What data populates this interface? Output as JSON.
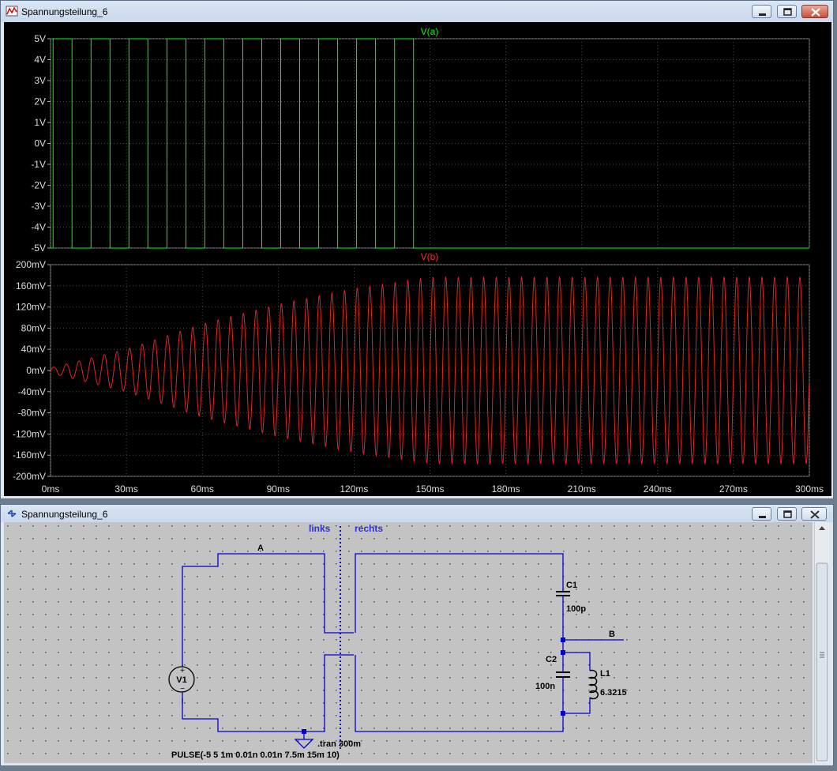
{
  "waveform_window": {
    "title": "Spannungsteilung_6",
    "buttons": {
      "minimize": "minimize-button",
      "maximize": "maximize-button",
      "close": "close-button"
    }
  },
  "schematic_window": {
    "title": "Spannungsteilung_6",
    "labels": {
      "left": "links",
      "right": "rechts",
      "node_a": "A",
      "node_b": "B",
      "c1": "C1",
      "c1_value": "100p",
      "c2": "C2",
      "c2_value": "100n",
      "l1": "L1",
      "l1_value": "6.3215",
      "v1": "V1",
      "directive": ".tran 300m",
      "source_value": "PULSE(-5 5 1m 0.01n 0.01n 7.5m 15m 10)"
    }
  },
  "colors": {
    "trace_a": "#00ff00",
    "trace_b": "#ff2a2a",
    "grid": "#4a4a4a",
    "wire": "#0000d0"
  },
  "chart_data": [
    {
      "type": "line",
      "title": "V(a)",
      "x_unit": "ms",
      "xlim": [
        0,
        300
      ],
      "ylim": [
        -5,
        5
      ],
      "x_ticks": [
        "0ms",
        "30ms",
        "60ms",
        "90ms",
        "120ms",
        "150ms",
        "180ms",
        "210ms",
        "240ms",
        "270ms",
        "300ms"
      ],
      "y_ticks": [
        "5V",
        "4V",
        "3V",
        "2V",
        "1V",
        "0V",
        "-1V",
        "-2V",
        "-3V",
        "-4V",
        "-5V"
      ],
      "series": [
        {
          "name": "V(a)",
          "x": [
            0,
            1,
            1,
            8.5,
            8.5,
            16,
            16,
            23.5,
            23.5,
            31,
            31,
            38.5,
            38.5,
            46,
            46,
            53.5,
            53.5,
            61,
            61,
            68.5,
            68.5,
            76,
            76,
            83.5,
            83.5,
            91,
            91,
            98.5,
            98.5,
            106,
            106,
            113.5,
            113.5,
            121,
            121,
            128.5,
            128.5,
            136,
            136,
            143.5,
            143.5,
            300
          ],
          "y": [
            -5,
            -5,
            5,
            5,
            -5,
            -5,
            5,
            5,
            -5,
            -5,
            5,
            5,
            -5,
            -5,
            5,
            5,
            -5,
            -5,
            5,
            5,
            -5,
            -5,
            5,
            5,
            -5,
            -5,
            5,
            5,
            -5,
            -5,
            5,
            5,
            -5,
            -5,
            5,
            5,
            -5,
            -5,
            5,
            5,
            -5,
            -5
          ]
        }
      ]
    },
    {
      "type": "line",
      "title": "V(b)",
      "x_unit": "ms",
      "xlim": [
        0,
        300
      ],
      "ylim": [
        -200,
        200
      ],
      "x_ticks": [
        "0ms",
        "30ms",
        "60ms",
        "90ms",
        "120ms",
        "150ms",
        "180ms",
        "210ms",
        "240ms",
        "270ms",
        "300ms"
      ],
      "y_ticks": [
        "200mV",
        "160mV",
        "120mV",
        "80mV",
        "40mV",
        "0mV",
        "-40mV",
        "-80mV",
        "-120mV",
        "-160mV",
        "-200mV"
      ],
      "series": [
        {
          "name": "V(b)",
          "frequency_hz": 200,
          "envelope": {
            "x": [
              0,
              30,
              60,
              90,
              120,
              150,
              300
            ],
            "amplitude": [
              5,
              40,
              88,
              125,
              155,
              176,
              176
            ]
          }
        }
      ]
    }
  ]
}
